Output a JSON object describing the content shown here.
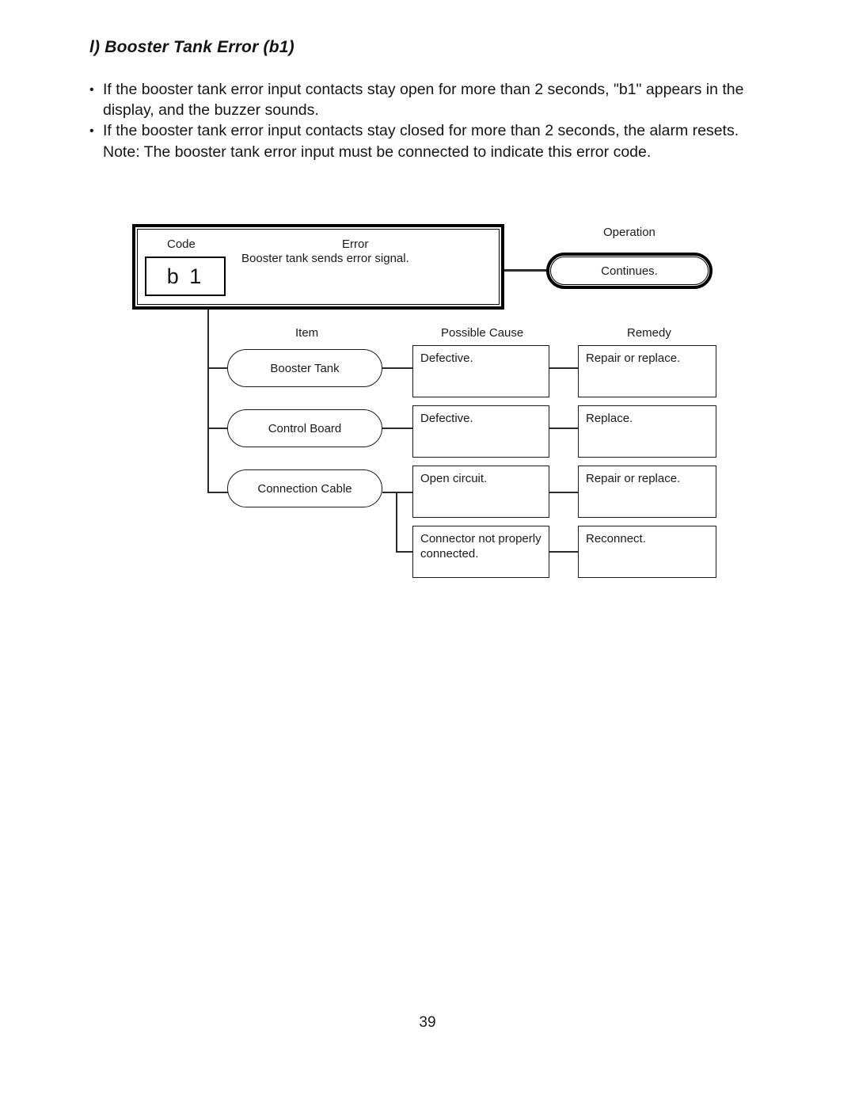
{
  "document": {
    "title": "l) Booster Tank Error (b1)",
    "page_number": "39"
  },
  "body": {
    "bullets": [
      "If the booster tank error input contacts stay open for more than 2 seconds, \"b1\" appears in the display, and the buzzer sounds.",
      "If the booster tank error input contacts stay closed for more than 2 seconds, the alarm resets."
    ],
    "bullet_marker": "•",
    "note": "Note: The booster tank error input must be connected to indicate this error code."
  },
  "diagram": {
    "headers": {
      "code": "Code",
      "error": "Error",
      "operation": "Operation",
      "item": "Item",
      "possible_cause": "Possible Cause",
      "remedy": "Remedy"
    },
    "code_value": "b 1",
    "error_text": "Booster tank sends error signal.",
    "operation_value": "Continues.",
    "rows": [
      {
        "item": "Booster Tank",
        "cause": "Defective.",
        "remedy": "Repair or replace."
      },
      {
        "item": "Control Board",
        "cause": "Defective.",
        "remedy": "Replace."
      },
      {
        "item": "Connection Cable",
        "cause": "Open circuit.",
        "remedy": "Repair or replace."
      },
      {
        "item": "",
        "cause": "Connector not properly connected.",
        "remedy": "Reconnect."
      }
    ]
  }
}
